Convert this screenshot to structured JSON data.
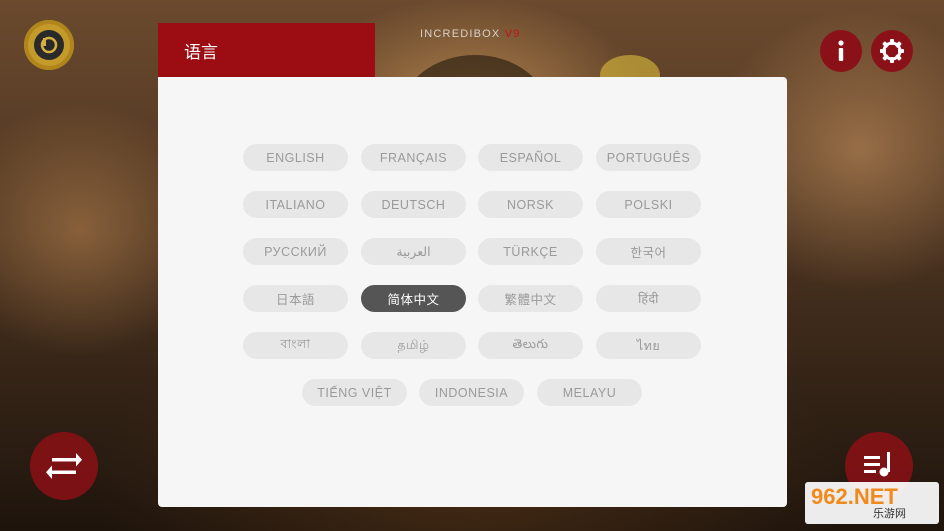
{
  "brand": {
    "name": "INCREDIBOX",
    "version": "V9"
  },
  "panel": {
    "title": "语言",
    "languages": [
      "ENGLISH",
      "FRANÇAIS",
      "ESPAÑOL",
      "PORTUGUÊS",
      "ITALIANO",
      "DEUTSCH",
      "NORSK",
      "POLSKI",
      "РУССКИЙ",
      "العربية",
      "TÜRKÇE",
      "한국어",
      "日本語",
      "简体中文",
      "繁體中文",
      "हिंदी",
      "বাংলা",
      "தமிழ்",
      "తెలుగు",
      "ไทย",
      "TIẾNG VIỆT",
      "INDONESIA",
      "MELAYU"
    ],
    "selected": "简体中文"
  },
  "icons": {
    "logo": "incredibox-logo-icon",
    "info": "info-icon",
    "settings": "gear-icon",
    "switch": "swap-arrows-icon",
    "mix": "music-list-icon"
  },
  "watermark": {
    "site": "962.NET",
    "caption": "乐游网"
  },
  "colors": {
    "accent": "#9b0d12",
    "selected_bg": "#555555",
    "chip_bg": "#e7e7e7"
  }
}
